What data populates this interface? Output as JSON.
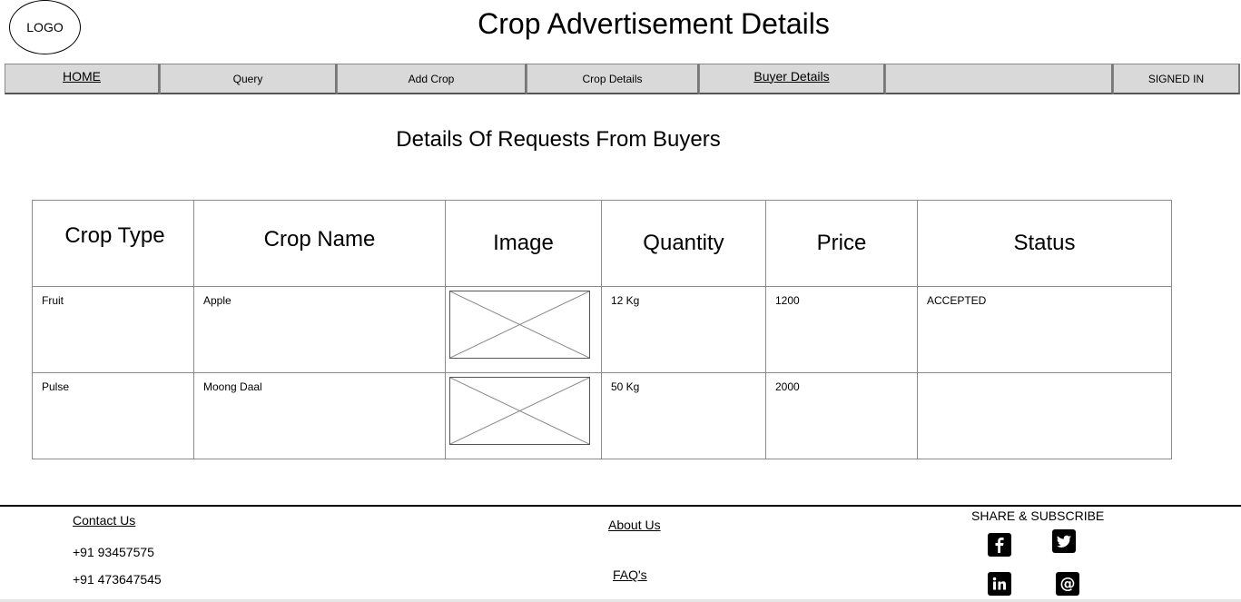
{
  "header": {
    "logo": "LOGO",
    "title": "Crop Advertisement Details"
  },
  "nav": {
    "home": "HOME",
    "query": "Query",
    "add_crop": "Add Crop",
    "crop_details": "Crop Details",
    "buyer_details": "Buyer Details",
    "blank": "",
    "signed_in": "SIGNED IN"
  },
  "main": {
    "section_title": "Details Of Requests From Buyers",
    "table": {
      "headers": [
        "Crop Type",
        "Crop Name",
        "Image",
        "Quantity",
        "Price",
        "Status"
      ],
      "rows": [
        {
          "crop_type": "Fruit",
          "crop_name": "Apple",
          "quantity": "12 Kg",
          "price": "1200",
          "status": "ACCEPTED"
        },
        {
          "crop_type": "Pulse",
          "crop_name": "Moong Daal",
          "quantity": "50 Kg",
          "price": "2000",
          "status": ""
        }
      ]
    }
  },
  "footer": {
    "contact_us": "Contact Us",
    "phone_1": "+91 93457575",
    "phone_2": "+91 473647545",
    "about_us": "About Us",
    "faqs": "FAQ's",
    "share_title": "SHARE & SUBSCRIBE",
    "social_icons": [
      "facebook-icon",
      "twitter-icon",
      "linkedin-icon",
      "email-icon"
    ]
  }
}
